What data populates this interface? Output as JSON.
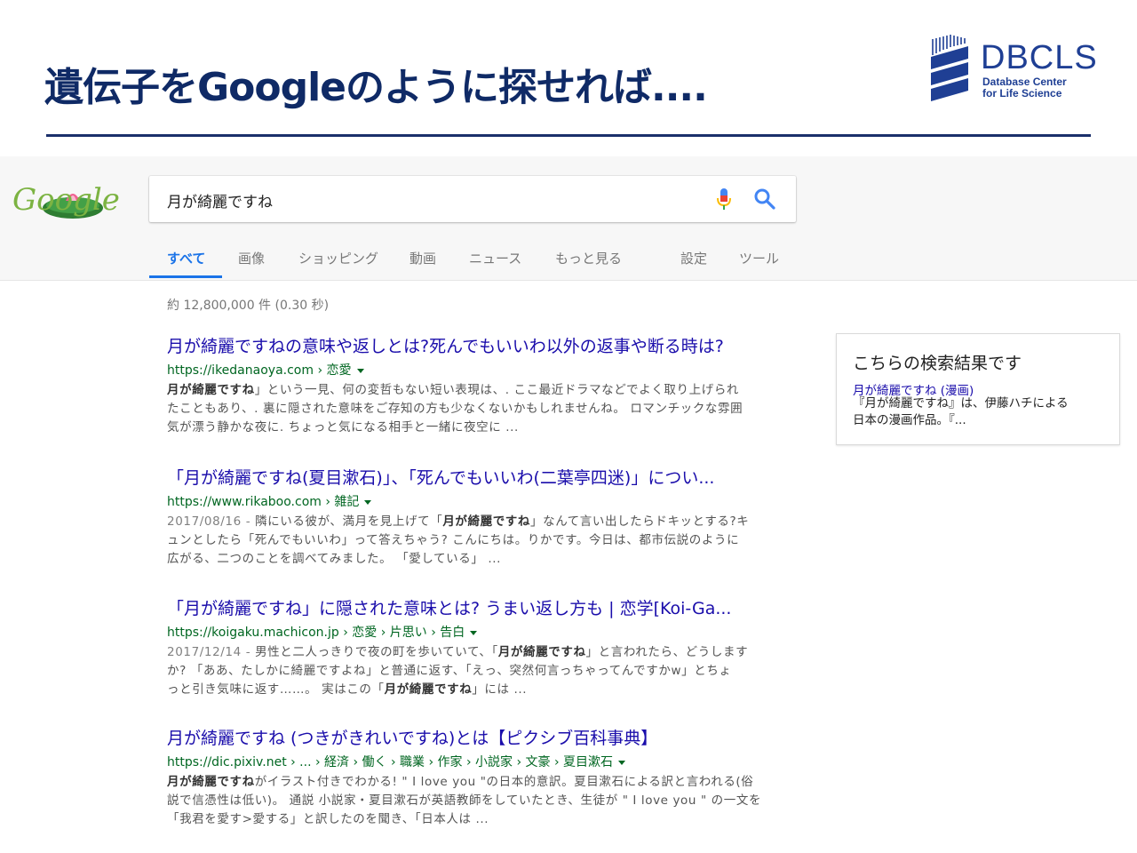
{
  "slide": {
    "title": "遺伝子をGoogleのように探せれば....",
    "logo": {
      "name": "DBCLS",
      "line1": "Database Center",
      "line2": "for Life Science"
    }
  },
  "google": {
    "logo_text": "Google",
    "query": "月が綺麗ですね",
    "tabs": [
      "すべて",
      "画像",
      "ショッピング",
      "動画",
      "ニュース",
      "もっと見る",
      "設定",
      "ツール"
    ],
    "active_tab": "すべて",
    "stats": "約 12,800,000 件 (0.30 秒)",
    "results": [
      {
        "title": "月が綺麗ですねの意味や返しとは?死んでもいいわ以外の返事や断る時は?",
        "url": "https://ikedanaoya.com › 恋愛",
        "snippet": [
          {
            "bold": "月が綺麗ですね",
            "text": "」という一見、何の変哲もない短い表現は、. ここ最近ドラマなどでよく取り上げられ"
          },
          {
            "text": "たこともあり、. 裏に隠された意味をご存知の方も少なくないかもしれませんね。 ロマンチックな雰囲"
          },
          {
            "text": "気が漂う静かな夜に. ちょっと気になる相手と一緒に夜空に ..."
          }
        ]
      },
      {
        "title": "「月が綺麗ですね(夏目漱石)」、「死んでもいいわ(二葉亭四迷)」につい...",
        "url": "https://www.rikaboo.com › 雑記",
        "snippet": [
          {
            "date": "2017/08/16 - ",
            "text": "隣にいる彼が、満月を見上げて「",
            "bold": "月が綺麗ですね",
            "after": "」なんて言い出したらドキッとする?キ"
          },
          {
            "text": "ュンとしたら「死んでもいいわ」って答えちゃう? こんにちは。りかです。今日は、都市伝説のように"
          },
          {
            "text": "広がる、二つのことを調べてみました。 「愛している」 ..."
          }
        ]
      },
      {
        "title": "「月が綺麗ですね」に隠された意味とは? うまい返し方も | 恋学[Koi-Ga...",
        "url": "https://koigaku.machicon.jp › 恋愛 › 片思い › 告白",
        "snippet": [
          {
            "date": "2017/12/14 - ",
            "text": "男性と二人っきりで夜の町を歩いていて、「",
            "bold": "月が綺麗ですね",
            "after": "」と言われたら、どうします"
          },
          {
            "text": "か? 「ああ、たしかに綺麗ですよね」と普通に返す、「えっ、突然何言っちゃってんですかw」とちょ"
          },
          {
            "text": "っと引き気味に返す……。 実はこの「",
            "bold": "月が綺麗ですね",
            "after": "」には ..."
          }
        ]
      },
      {
        "title": "月が綺麗ですね (つきがきれいですね)とは【ピクシブ百科事典】",
        "url": "https://dic.pixiv.net › ... › 経済 › 働く › 職業 › 作家 › 小説家 › 文豪 › 夏目漱石",
        "snippet": [
          {
            "bold": "月が綺麗ですね",
            "after": "がイラスト付きでわかる! \" I love you \"の日本的意訳。夏目漱石による訳と言われる(俗"
          },
          {
            "text": "説で信憑性は低い)。 通説 小説家・夏目漱石が英語教師をしていたとき、生徒が \" I love you \" の一文を"
          },
          {
            "text": "「我君を愛す>愛する」と訳したのを聞き、「日本人は ..."
          }
        ]
      }
    ],
    "panel": {
      "title": "こちらの検索結果です",
      "link": "月が綺麗ですね (漫画)",
      "desc_line1": "『月が綺麗ですね』は、伊藤ハチによる",
      "desc_line2": "日本の漫画作品。『..."
    }
  }
}
